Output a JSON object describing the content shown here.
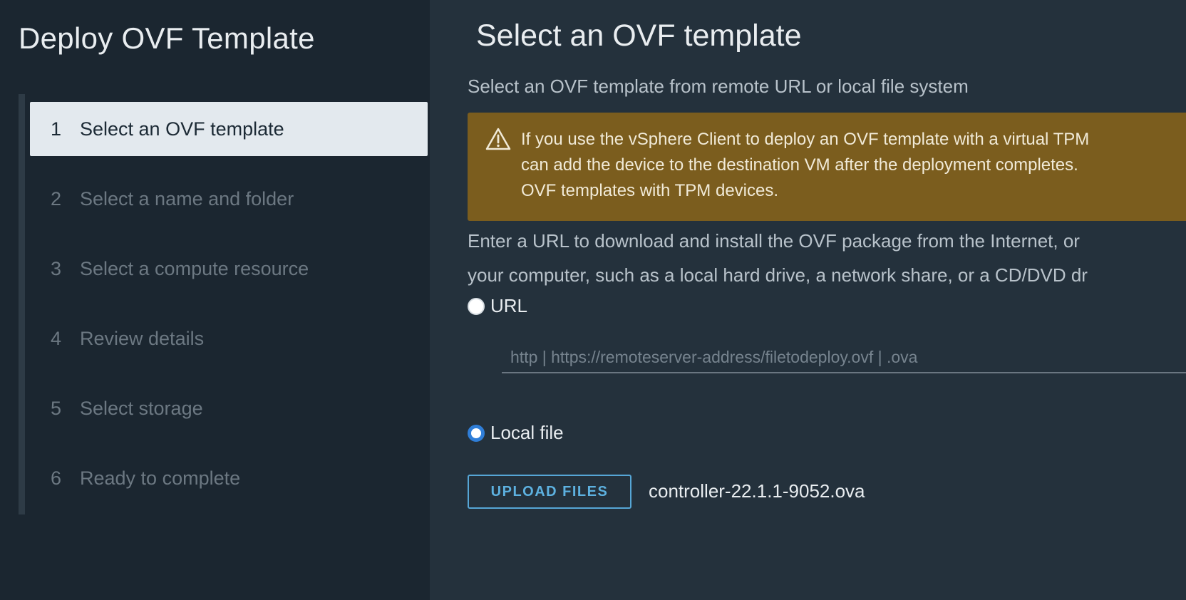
{
  "sidebar": {
    "title": "Deploy OVF Template",
    "steps": [
      {
        "num": "1",
        "label": "Select an OVF template",
        "active": true
      },
      {
        "num": "2",
        "label": "Select a name and folder",
        "active": false
      },
      {
        "num": "3",
        "label": "Select a compute resource",
        "active": false
      },
      {
        "num": "4",
        "label": "Review details",
        "active": false
      },
      {
        "num": "5",
        "label": "Select storage",
        "active": false
      },
      {
        "num": "6",
        "label": "Ready to complete",
        "active": false
      }
    ]
  },
  "main": {
    "title": "Select an OVF template",
    "subtitle": "Select an OVF template from remote URL or local file system",
    "alert": {
      "icon": "warning-icon",
      "text": "If you use the vSphere Client to deploy an OVF template with a virtual TPM\ncan add the device to the destination VM after the deployment completes.\nOVF templates with TPM devices."
    },
    "instructions": "Enter a URL to download and install the OVF package from the Internet, or\nyour computer, such as a local hard drive, a network share, or a CD/DVD dr",
    "url_option": {
      "label": "URL",
      "checked": false
    },
    "url_input": {
      "value": "",
      "placeholder": "http | https://remoteserver-address/filetodeploy.ovf | .ova"
    },
    "local_option": {
      "label": "Local file",
      "checked": true
    },
    "upload_button": "UPLOAD FILES",
    "selected_file": "controller-22.1.1-9052.ova"
  },
  "colors": {
    "sidebar_bg": "#1b2630",
    "main_bg": "#24313c",
    "alert_bg": "#7b5d1e",
    "accent": "#5db1e0",
    "radio_checked": "#2f7ed8"
  }
}
